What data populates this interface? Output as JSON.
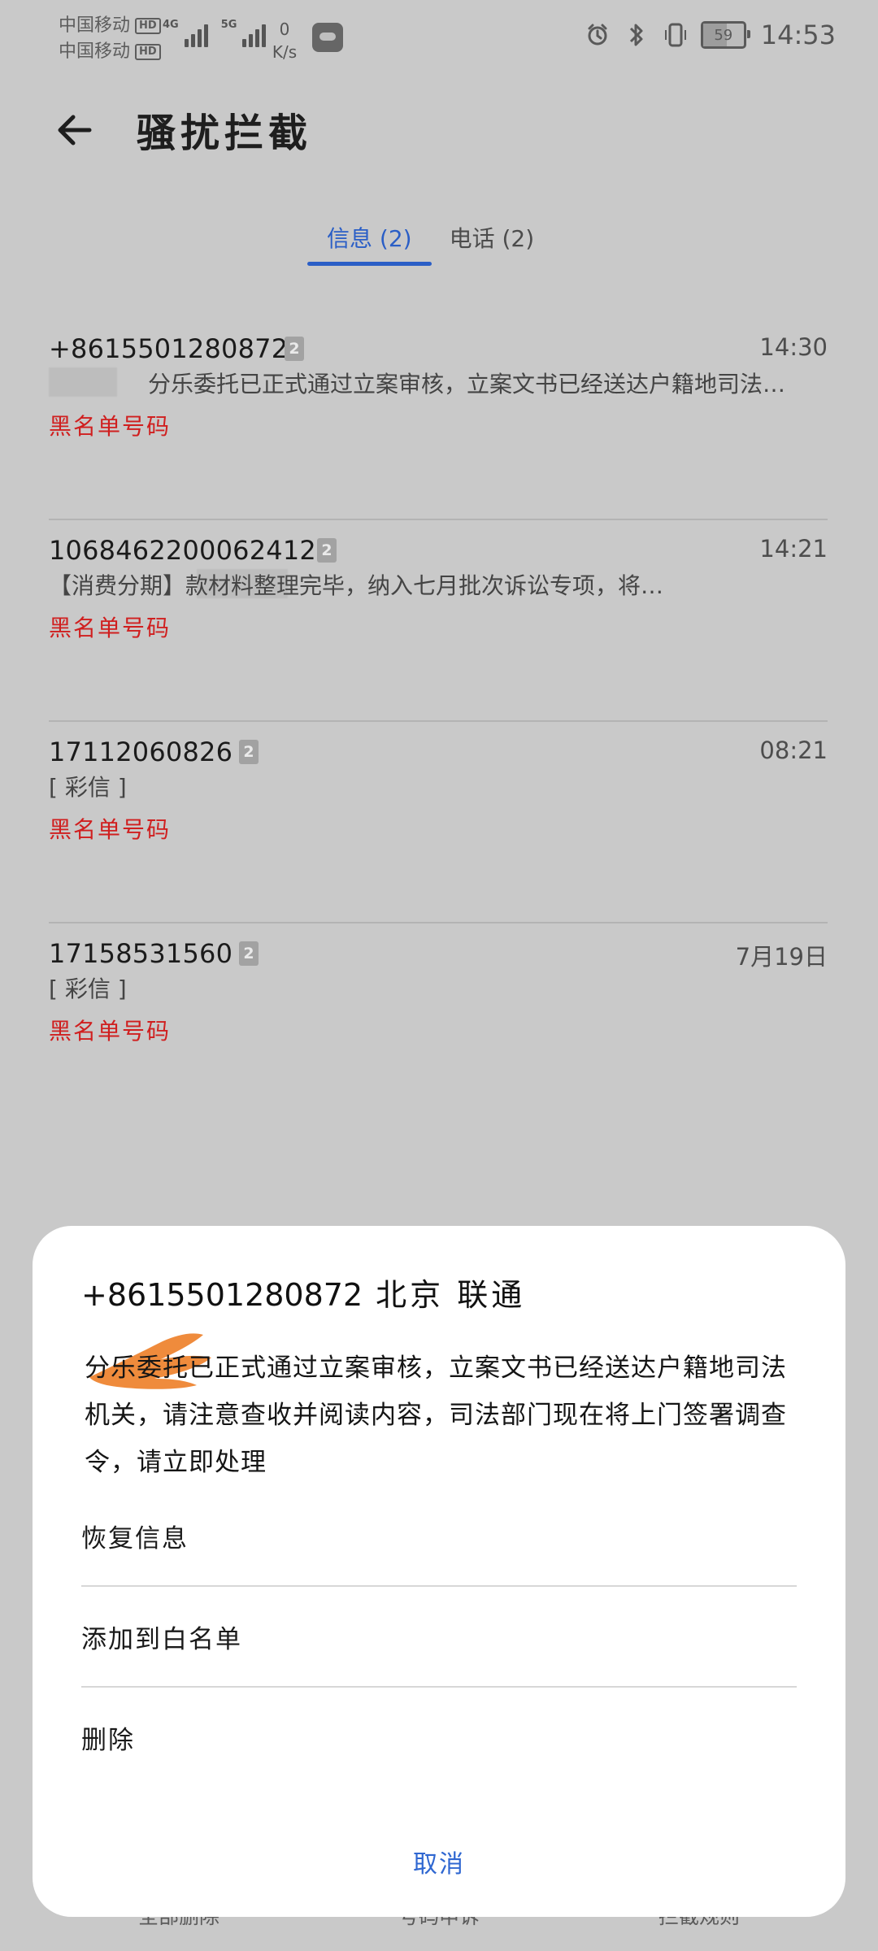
{
  "status_bar": {
    "carrier_1": "中国移动",
    "carrier_2": "中国移动",
    "hd_label": "HD",
    "signal_1_tag": "4G",
    "signal_2_tag": "5G",
    "net_speed_value": "0",
    "net_speed_unit": "K/s",
    "battery_level": "59",
    "time": "14:53",
    "icons": [
      "alarm-icon",
      "bluetooth-icon",
      "vibrate-icon",
      "battery-icon"
    ]
  },
  "header": {
    "title": "骚扰拦截",
    "back_icon": "back-arrow-icon"
  },
  "tabs": [
    {
      "label": "信息 (2)",
      "active": true
    },
    {
      "label": "电话 (2)",
      "active": false
    }
  ],
  "messages": [
    {
      "phone": "+8615501280872",
      "sim": "2",
      "time": "14:30",
      "preview": "分乐委托已正式通过立案审核，立案文书已经送达户籍地司法…",
      "label": "黑名单号码"
    },
    {
      "phone": "1068462200062412",
      "sim": "2",
      "time": "14:21",
      "preview": "【消费分期】款材料整理完毕，纳入七月批次诉讼专项，将…",
      "label": "黑名单号码"
    },
    {
      "phone": "17112060826",
      "sim": "2",
      "time": "08:21",
      "preview": "[ 彩信 ]",
      "label": "黑名单号码"
    },
    {
      "phone": "17158531560",
      "sim": "2",
      "time": "7月19日",
      "preview": "[ 彩信 ]",
      "label": "黑名单号码"
    }
  ],
  "sheet": {
    "phone": "+8615501280872",
    "location": "北京 联通",
    "message": "分乐委托已正式通过立案审核，立案文书已经送达户籍地司法机关，请注意查收并阅读内容，司法部门现在将上门签署调查令，请立即处理",
    "actions": [
      "恢复信息",
      "添加到白名单",
      "删除"
    ],
    "cancel": "取消"
  },
  "toolbar": {
    "items": [
      "全部删除",
      "号码申诉",
      "拦截规则"
    ]
  },
  "colors": {
    "accent_blue": "#2a5ec6",
    "blacklist_red": "#d01f1f",
    "sheet_background": "#ffffff",
    "screen_background": "#c9c9c9",
    "redaction_orange": "#ef8b3c"
  }
}
